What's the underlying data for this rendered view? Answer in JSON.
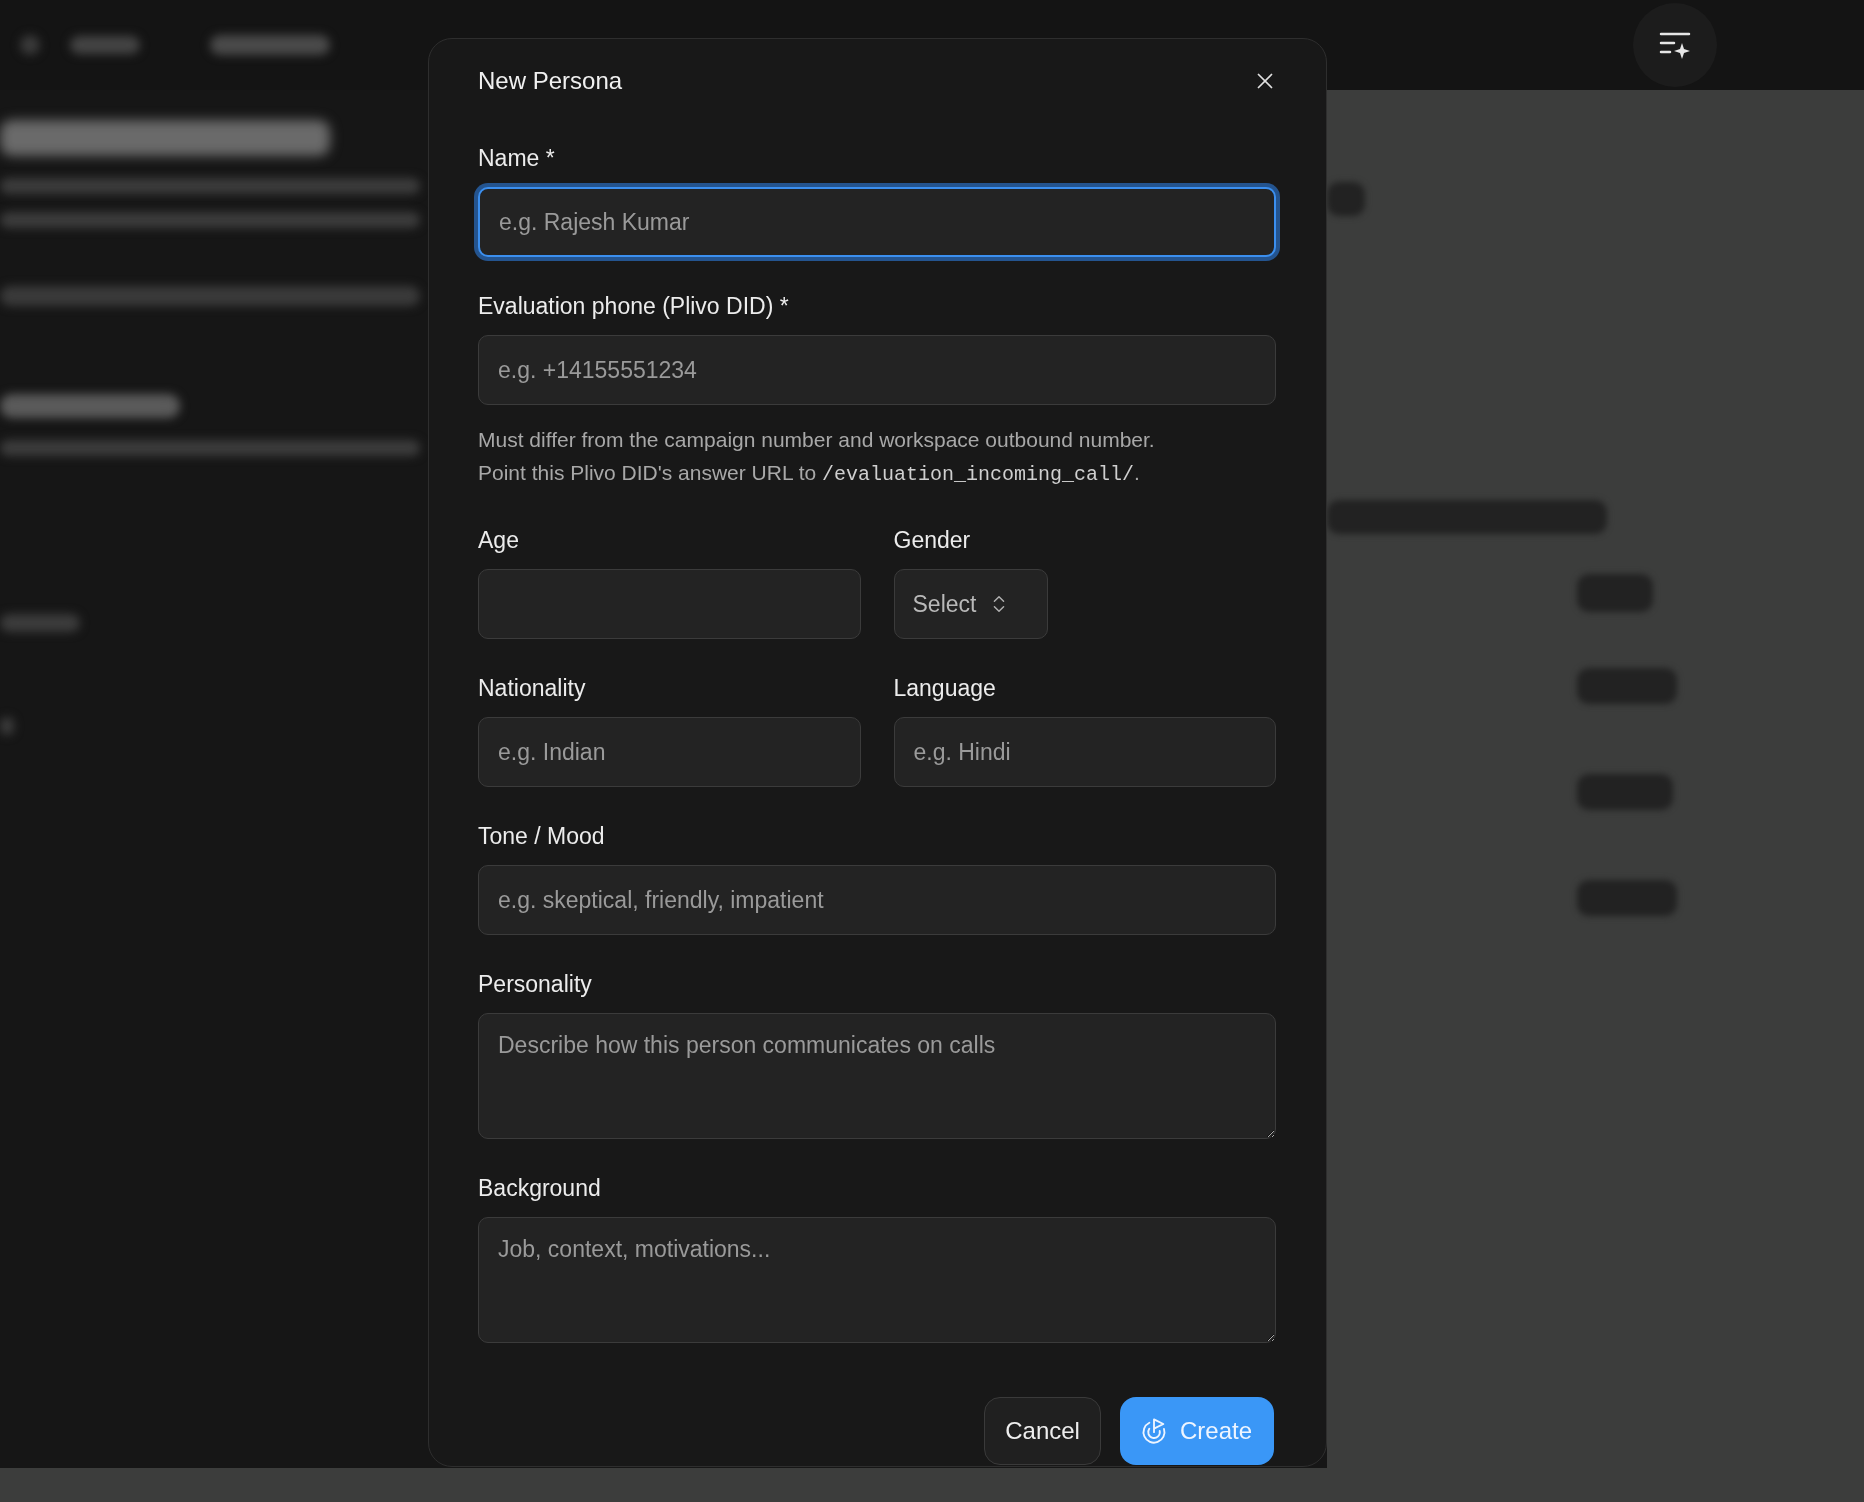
{
  "toolbar": {
    "assistant_button": true
  },
  "dialog": {
    "title": "New Persona",
    "rows": [
      [
        {
          "kind": "text",
          "label": "Name *",
          "placeholder": "e.g. Rajesh Kumar",
          "focused": true
        }
      ],
      [
        {
          "kind": "text",
          "label": "Evaluation phone (Plivo DID) *",
          "placeholder": "e.g. +14155551234",
          "focused": false,
          "hint": {
            "lines": [
              "Must differ from the campaign number and workspace outbound number."
            ],
            "before": "Point this Plivo DID's answer URL to ",
            "code": "/evaluation_incoming_call/",
            "after": "."
          }
        }
      ],
      [
        {
          "kind": "text",
          "label": "Age",
          "focused": false
        },
        {
          "kind": "select",
          "label": "Gender",
          "value": "Select"
        }
      ],
      [
        {
          "kind": "text",
          "label": "Nationality",
          "placeholder": "e.g. Indian",
          "focused": false
        },
        {
          "kind": "text",
          "label": "Language",
          "placeholder": "e.g. Hindi",
          "focused": false
        }
      ],
      [
        {
          "kind": "text",
          "label": "Tone / Mood",
          "placeholder": "e.g. skeptical, friendly, impatient",
          "focused": false
        }
      ],
      [
        {
          "kind": "textarea",
          "label": "Personality",
          "placeholder": "Describe how this person communicates on calls"
        }
      ],
      [
        {
          "kind": "textarea",
          "label": "Background",
          "placeholder": "Job, context, motivations..."
        }
      ]
    ],
    "buttons": [
      {
        "kind": "secondary",
        "label": "Cancel"
      },
      {
        "kind": "primary",
        "label": "Create"
      }
    ]
  }
}
